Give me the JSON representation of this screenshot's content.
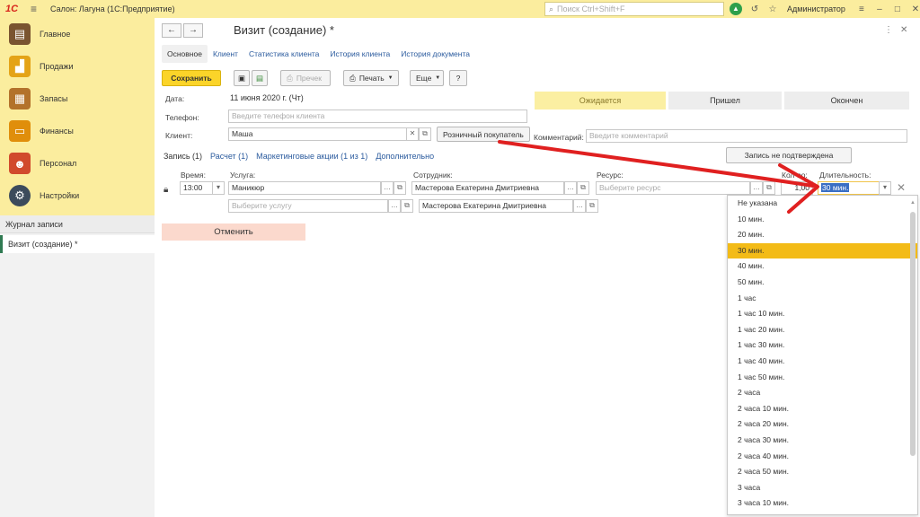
{
  "titlebar": {
    "logo": "1С",
    "app_title": "Салон: Лагуна  (1С:Предприятие)",
    "search_placeholder": "Поиск Ctrl+Shift+F",
    "user": "Администратор"
  },
  "sidebar": {
    "items": [
      {
        "label": "Главное",
        "icon": "home-icon"
      },
      {
        "label": "Продажи",
        "icon": "sales-chart-icon"
      },
      {
        "label": "Запасы",
        "icon": "stock-icon"
      },
      {
        "label": "Финансы",
        "icon": "wallet-icon"
      },
      {
        "label": "Персонал",
        "icon": "people-icon"
      },
      {
        "label": "Настройки",
        "icon": "gear-icon"
      }
    ],
    "journal_title": "Журнал записи",
    "journal_item": "Визит (создание) *"
  },
  "form": {
    "title": "Визит (создание) *",
    "tabs": [
      "Основное",
      "Клиент",
      "Статистика клиента",
      "История клиента",
      "История документа"
    ],
    "toolbar": {
      "save": "Сохранить",
      "precheck": "Пречек",
      "print": "Печать",
      "more": "Еще",
      "help": "?"
    },
    "date_label": "Дата:",
    "date_value": "11 июня 2020 г. (Чт)",
    "phone_label": "Телефон:",
    "phone_placeholder": "Введите телефон клиента",
    "client_label": "Клиент:",
    "client_value": "Маша",
    "retail_button": "Розничный покупатель",
    "status_buttons": [
      "Ожидается",
      "Пришел",
      "Окончен"
    ],
    "comment_label": "Комментарий:",
    "comment_placeholder": "Введите комментарий",
    "not_confirmed": "Запись не подтверждена",
    "subtabs": [
      "Запись (1)",
      "Расчет (1)",
      "Маркетинговые акции (1 из 1)",
      "Дополнительно"
    ],
    "row": {
      "time_label": "Время:",
      "time_value": "13:00",
      "service_label": "Услуга:",
      "service_value": "Маникюр",
      "employee_label": "Сотрудник:",
      "employee_value": "Мастерова Екатерина Дмитриевна",
      "resource_label": "Ресурс:",
      "resource_placeholder": "Выберите ресурс",
      "qty_label": "Кол-во:",
      "qty_value": "1,00",
      "duration_label": "Длительность:",
      "duration_value": "30 мин.",
      "service2_placeholder": "Выберите услугу",
      "employee2_value": "Мастерова Екатерина Дмитриевна"
    },
    "cancel_button": "Отменить"
  },
  "dropdown": {
    "selected": "30 мин.",
    "options": [
      "Не указана",
      "10 мин.",
      "20 мин.",
      "30 мин.",
      "40 мин.",
      "50 мин.",
      "1 час",
      "1 час 10 мин.",
      "1 час 20 мин.",
      "1 час 30 мин.",
      "1 час 40 мин.",
      "1 час 50 мин.",
      "2 часа",
      "2 часа 10 мин.",
      "2 часа 20 мин.",
      "2 часа 30 мин.",
      "2 часа 40 мин.",
      "2 часа 50 мин.",
      "3 часа",
      "3 часа 10 мин."
    ]
  },
  "colors": {
    "accent_yellow": "#fbed9e",
    "save_button": "#fbd429",
    "selected_option": "#f3bb17",
    "annotation_arrow": "#e02020"
  }
}
